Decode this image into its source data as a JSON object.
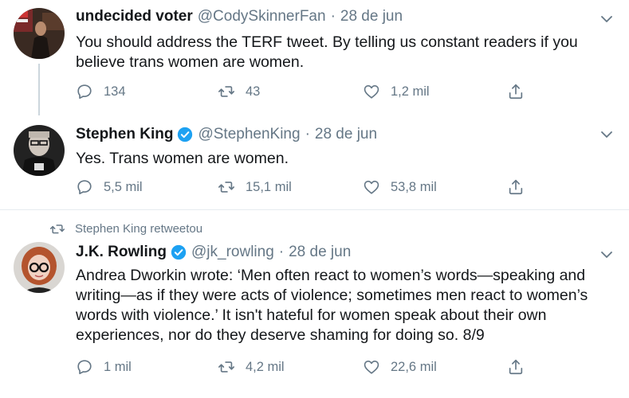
{
  "tweets": [
    {
      "name": "undecided voter",
      "handle": "@CodySkinnerFan",
      "date": "28 de jun",
      "text": "You should address the TERF tweet. By telling us constant readers if you believe trans women are women.",
      "replies": "134",
      "retweets": "43",
      "likes": "1,2 mil"
    },
    {
      "name": "Stephen King",
      "handle": "@StephenKing",
      "date": "28 de jun",
      "text": "Yes. Trans women are women.",
      "replies": "5,5 mil",
      "retweets": "15,1 mil",
      "likes": "53,8 mil"
    },
    {
      "retweeted_by": "Stephen King retweetou",
      "name": "J.K. Rowling",
      "handle": "@jk_rowling",
      "date": "28 de jun",
      "text": "Andrea Dworkin wrote: ‘Men often react to women’s words—speaking and writing—as if they were acts of violence; sometimes men react to women’s words with violence.’ It isn't hateful for women speak about their own experiences, nor do they deserve shaming for doing so. 8/9",
      "replies": "1 mil",
      "retweets": "4,2 mil",
      "likes": "22,6 mil"
    }
  ],
  "dot": "·",
  "colors": {
    "verified": "#1da1f2",
    "muted": "#657786",
    "divider": "#e6ecf0"
  }
}
